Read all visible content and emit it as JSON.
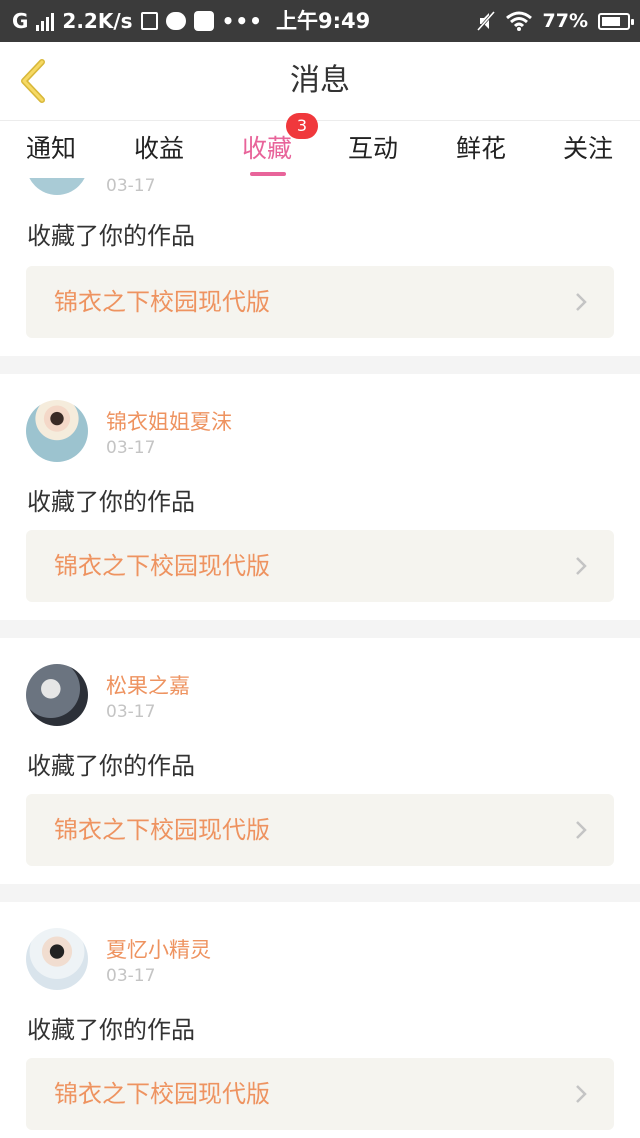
{
  "status_bar": {
    "carrier": "G",
    "speed": "2.2K/s",
    "dots": "•••",
    "time": "上午9:49",
    "battery": "77%",
    "battery_level": 0.77
  },
  "header": {
    "back_icon": "chevron-left-icon",
    "title": "消息"
  },
  "tabs": {
    "items": [
      {
        "label": "通知"
      },
      {
        "label": "收益"
      },
      {
        "label": "收藏",
        "active": true,
        "badge": "3"
      },
      {
        "label": "互动"
      },
      {
        "label": "鲜花"
      },
      {
        "label": "关注"
      }
    ]
  },
  "colors": {
    "accent": "#e8649a",
    "name": "#ee9360",
    "badge": "#f0383c"
  },
  "messages": [
    {
      "user": "",
      "date": "03-17",
      "action": "收藏了你的作品",
      "work": "锦衣之下校园现代版"
    },
    {
      "user": "锦衣姐姐夏沫",
      "date": "03-17",
      "action": "收藏了你的作品",
      "work": "锦衣之下校园现代版"
    },
    {
      "user": "松果之嘉",
      "date": "03-17",
      "action": "收藏了你的作品",
      "work": "锦衣之下校园现代版"
    },
    {
      "user": "夏忆小精灵",
      "date": "03-17",
      "action": "收藏了你的作品",
      "work": "锦衣之下校园现代版"
    }
  ]
}
